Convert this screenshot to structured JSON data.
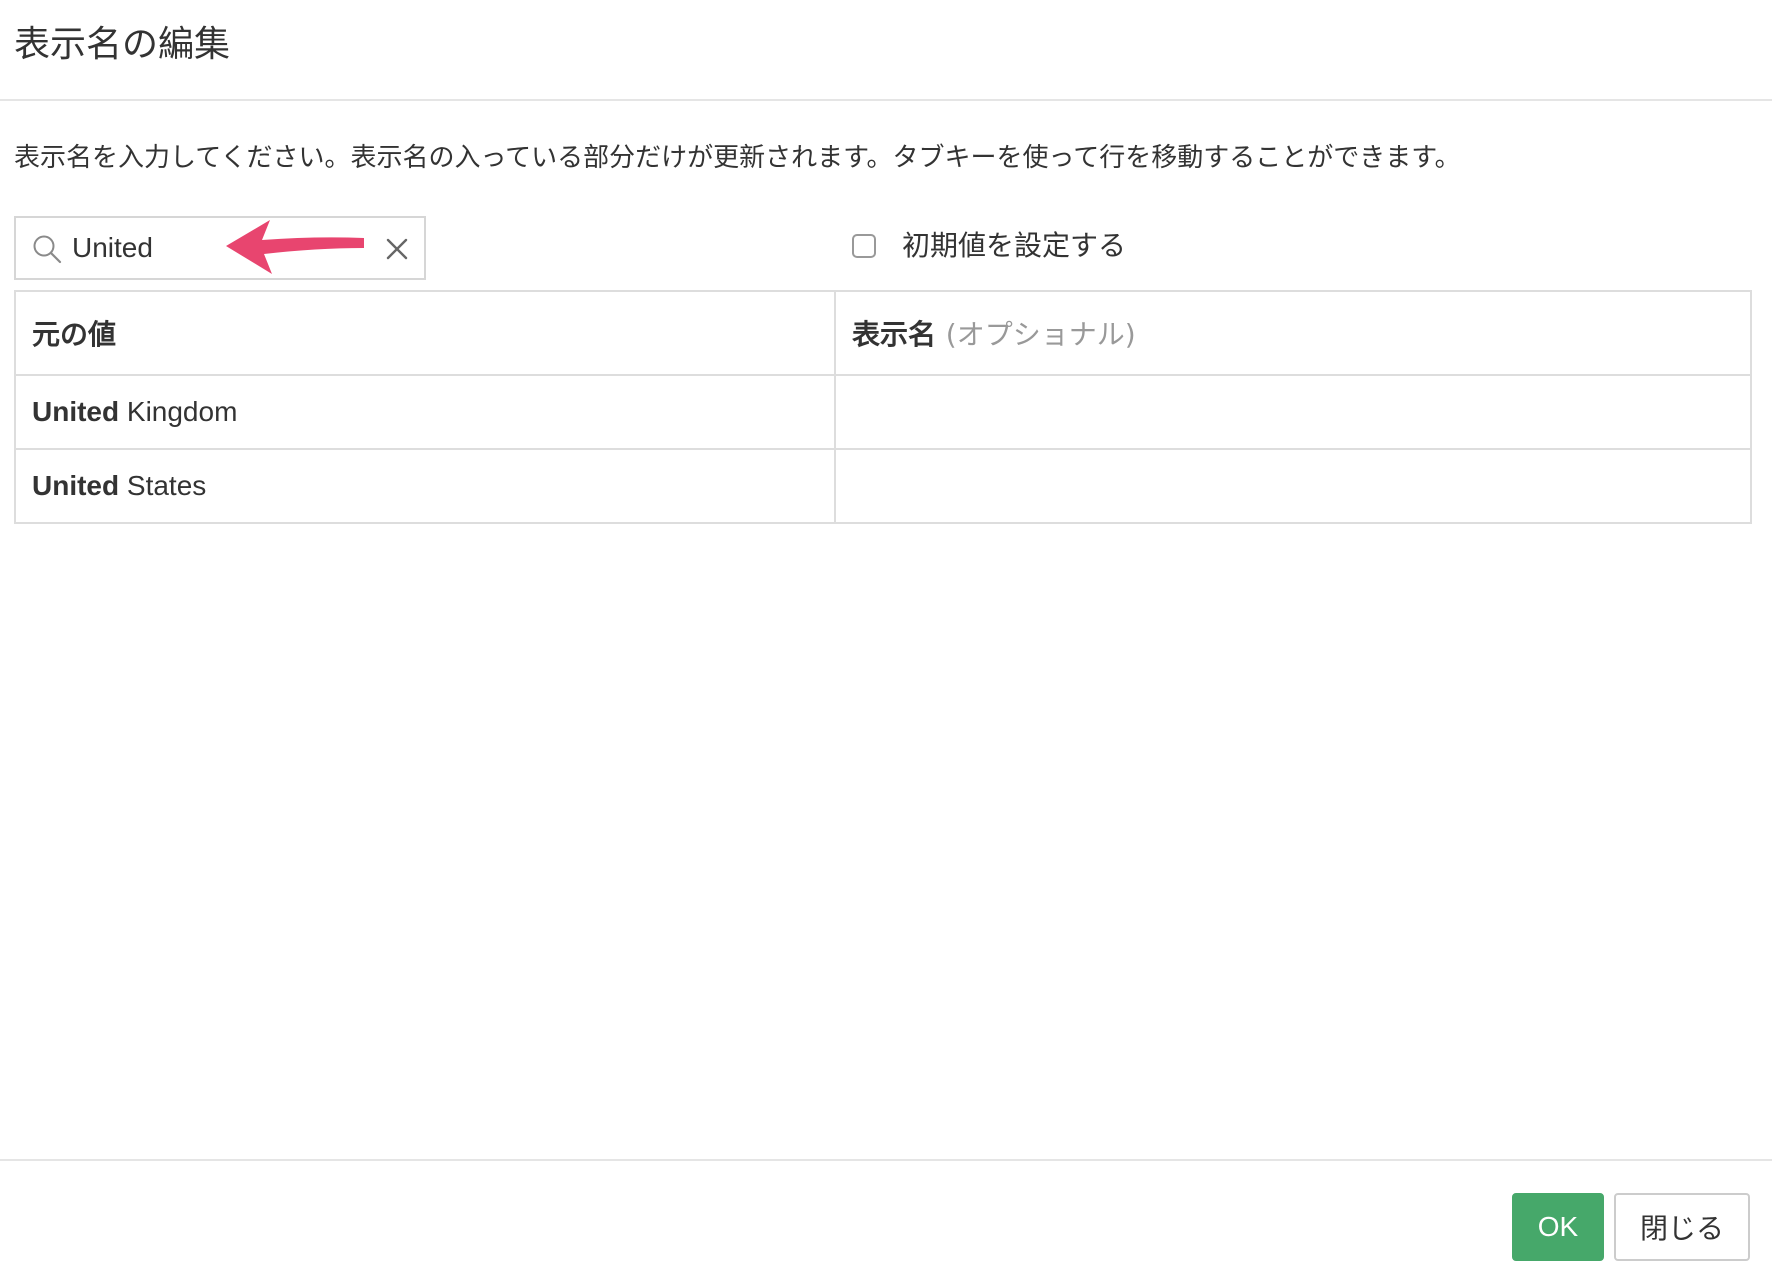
{
  "dialog": {
    "title": "表示名の編集",
    "instructions": "表示名を入力してください。表示名の入っている部分だけが更新されます。タブキーを使って行を移動することができます。"
  },
  "search": {
    "value": "United",
    "icon": "search-icon",
    "clear_icon": "close-icon"
  },
  "annotation": {
    "arrow_color": "#e8456f"
  },
  "default_option": {
    "label": "初期値を設定する",
    "checked": false
  },
  "table": {
    "headers": {
      "original": "元の値",
      "display": "表示名",
      "display_optional": "(オプショナル)"
    },
    "rows": [
      {
        "match": "United",
        "rest": " Kingdom",
        "display": ""
      },
      {
        "match": "United",
        "rest": " States",
        "display": ""
      }
    ]
  },
  "footer": {
    "ok_label": "OK",
    "close_label": "閉じる"
  },
  "colors": {
    "ok_button": "#46a86a",
    "border": "#dddddd",
    "optional_text": "#999999"
  }
}
